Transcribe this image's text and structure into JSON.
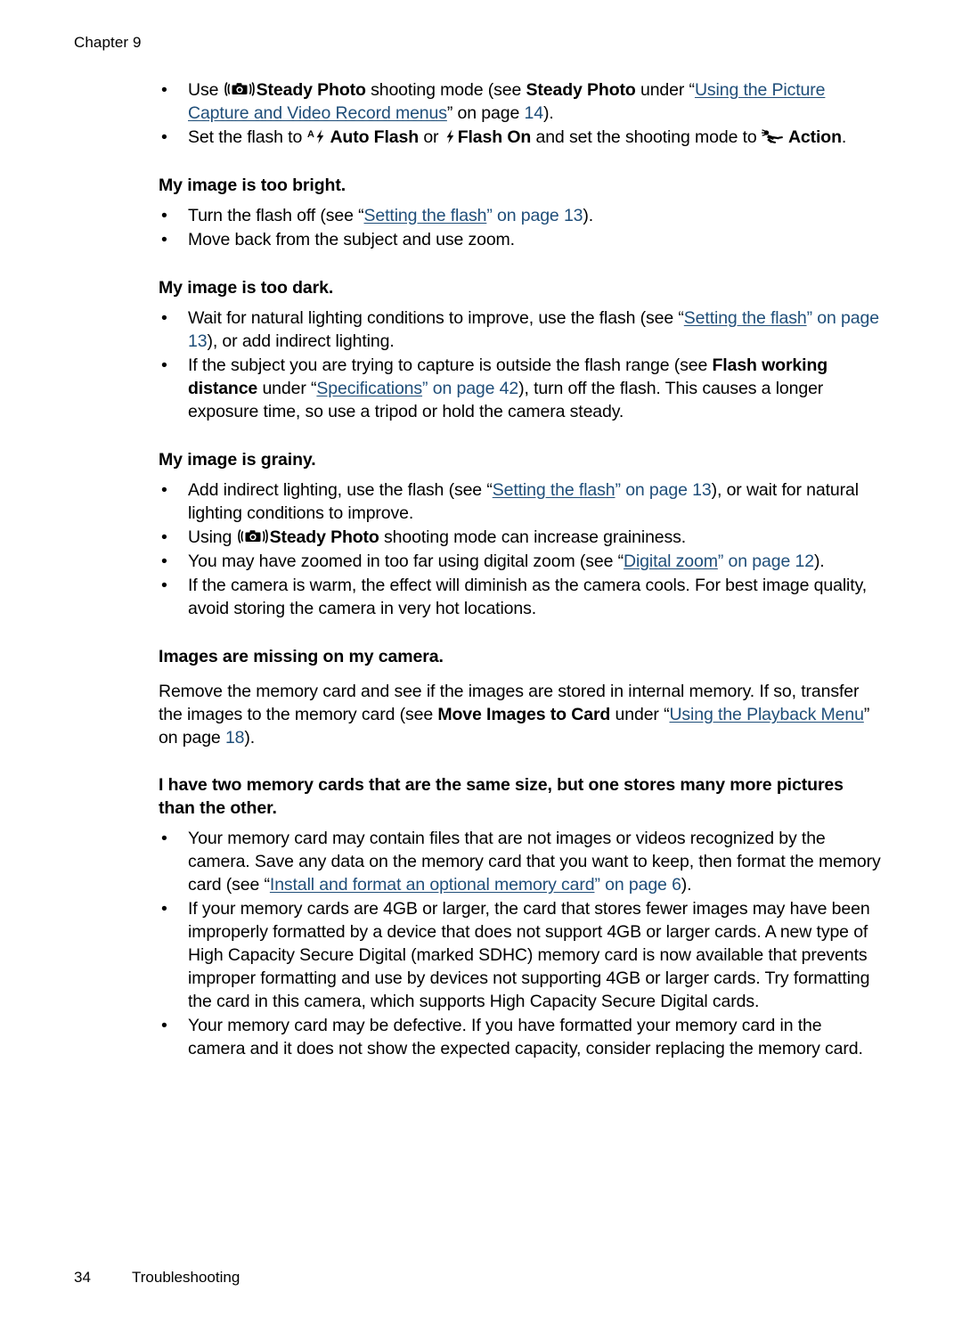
{
  "header": {
    "chapter_label": "Chapter 9"
  },
  "footer": {
    "page_number": "34",
    "section_label": "Troubleshooting"
  },
  "icons": {
    "steady_photo": "steady-photo-icon",
    "auto_flash": "auto-flash-icon",
    "flash_on": "flash-on-icon",
    "action": "action-icon"
  },
  "colors": {
    "link": "#1f4e79",
    "text": "#000000",
    "background": "#ffffff"
  },
  "intro_bullets": [
    {
      "id": "steady-photo-bullet",
      "segments": [
        {
          "type": "text",
          "value": "Use "
        },
        {
          "type": "icon",
          "value": "steady-photo-icon"
        },
        {
          "type": "bold",
          "value": "Steady Photo"
        },
        {
          "type": "text",
          "value": " shooting mode (see "
        },
        {
          "type": "bold",
          "value": "Steady Photo"
        },
        {
          "type": "text",
          "value": " under “"
        },
        {
          "type": "link",
          "value": "Using the Picture Capture and Video Record menus"
        },
        {
          "type": "text",
          "value": "” on page "
        },
        {
          "type": "link-plain",
          "value": "14"
        },
        {
          "type": "text",
          "value": ")."
        }
      ]
    },
    {
      "id": "set-flash-bullet",
      "segments": [
        {
          "type": "text",
          "value": "Set the flash to "
        },
        {
          "type": "icon",
          "value": "auto-flash-icon"
        },
        {
          "type": "bold",
          "value": "Auto Flash"
        },
        {
          "type": "text",
          "value": " or "
        },
        {
          "type": "icon",
          "value": "flash-on-icon"
        },
        {
          "type": "bold",
          "value": "Flash On"
        },
        {
          "type": "text",
          "value": " and set the shooting mode to "
        },
        {
          "type": "icon",
          "value": "action-icon"
        },
        {
          "type": "bold",
          "value": "Action"
        },
        {
          "type": "text",
          "value": "."
        }
      ]
    }
  ],
  "sections": [
    {
      "id": "too-bright",
      "heading": "My image is too bright.",
      "bullets": [
        "Turn the flash off (see “Setting the flash” on page 13).",
        "Move back from the subject and use zoom."
      ]
    },
    {
      "id": "too-dark",
      "heading": "My image is too dark.",
      "bullets": [
        "Wait for natural lighting conditions to improve, use the flash (see “Setting the flash” on page 13), or add indirect lighting.",
        "If the subject you are trying to capture is outside the flash range (see Flash working distance under “Specifications” on page 42), turn off the flash. This causes a longer exposure time, so use a tripod or hold the camera steady."
      ]
    },
    {
      "id": "grainy",
      "heading": "My image is grainy.",
      "bullets": [
        "Add indirect lighting, use the flash (see “Setting the flash” on page 13), or wait for natural lighting conditions to improve.",
        "Using  Steady Photo shooting mode can increase graininess.",
        "You may have zoomed in too far using digital zoom (see “Digital zoom” on page 12).",
        "If the camera is warm, the effect will diminish as the camera cools. For best image quality, avoid storing the camera in very hot locations."
      ]
    },
    {
      "id": "images-missing",
      "heading": "Images are missing on my camera.",
      "paragraph": "Remove the memory card and see if the images are stored in internal memory. If so, transfer the images to the memory card (see Move Images to Card under “Using the Playback Menu” on page 18)."
    },
    {
      "id": "two-memory-cards",
      "heading": "I have two memory cards that are the same size, but one stores many more pictures than the other.",
      "bullets": [
        "Your memory card may contain files that are not images or videos recognized by the camera. Save any data on the memory card that you want to keep, then format the memory card (see “Install and format an optional memory card” on page 6).",
        "If your memory cards are 4GB or larger, the card that stores fewer images may have been improperly formatted by a device that does not support 4GB or larger cards. A new type of High Capacity Secure Digital (marked SDHC) memory card is now available that prevents improper formatting and use by devices not supporting 4GB or larger cards. Try formatting the card in this camera, which supports High Capacity Secure Digital cards.",
        "Your memory card may be defective. If you have formatted your memory card in the camera and it does not show the expected capacity, consider replacing the memory card."
      ]
    }
  ],
  "inline": {
    "bullet_glyph": "•",
    "b1_use": "Use ",
    "b1_steady_bold_1": "Steady Photo",
    "b1_mid": " shooting mode (see ",
    "b1_steady_bold_2": "Steady Photo",
    "b1_under": " under “",
    "b1_link": "Using the Picture Capture and Video Record menus",
    "b1_onpage": "” on page ",
    "b1_pagenum": "14",
    "b1_end": ").",
    "b2_set": "Set the flash to ",
    "b2_auto_bold": "Auto Flash",
    "b2_or": " or ",
    "b2_flash_bold": "Flash On",
    "b2_and": " and set the shooting mode to ",
    "b2_action_bold": "Action",
    "b2_end": ".",
    "s1_b1_a": "Turn the flash off (see “",
    "s1_b1_link": "Setting the flash",
    "s1_b1_b": "” on page ",
    "s1_b1_pg": "13",
    "s1_b1_c": ").",
    "s1_b2": "Move back from the subject and use zoom.",
    "s2_b1_a": "Wait for natural lighting conditions to improve, use the flash (see “",
    "s2_b1_link": "Setting the flash",
    "s2_b1_b": "” ",
    "s2_b1_link2": "on page 13",
    "s2_b1_c": "), or add indirect lighting.",
    "s2_b2_a": "If the subject you are trying to capture is outside the flash range (see ",
    "s2_b2_bold": "Flash working distance",
    "s2_b2_b": " under “",
    "s2_b2_link": "Specifications",
    "s2_b2_c": "” ",
    "s2_b2_link2": "on page 42",
    "s2_b2_d": "), turn off the flash. This causes a longer exposure time, so use a tripod or hold the camera steady.",
    "s3_b1_a": "Add indirect lighting, use the flash (see “",
    "s3_b1_link": "Setting the flash",
    "s3_b1_b": "” ",
    "s3_b1_link2": "on page 13",
    "s3_b1_c": "), or wait for natural lighting conditions to improve.",
    "s3_b2_a": "Using ",
    "s3_b2_bold": "Steady Photo",
    "s3_b2_b": " shooting mode can increase graininess.",
    "s3_b3_a": "You may have zoomed in too far using digital zoom (see “",
    "s3_b3_link": "Digital zoom",
    "s3_b3_b": "” ",
    "s3_b3_link2": "on page 12",
    "s3_b3_c": ").",
    "s3_b4": "If the camera is warm, the effect will diminish as the camera cools. For best image quality, avoid storing the camera in very hot locations.",
    "s4_p_a": "Remove the memory card and see if the images are stored in internal memory. If so, transfer the images to the memory card (see ",
    "s4_p_bold": "Move Images to Card",
    "s4_p_b": " under “",
    "s4_p_link": "Using the Playback Menu",
    "s4_p_c": "” on page ",
    "s4_p_pg": "18",
    "s4_p_d": ").",
    "s5_b1_a": "Your memory card may contain files that are not images or videos recognized by the camera. Save any data on the memory card that you want to keep, then format the memory card (see “",
    "s5_b1_link": "Install and format an optional memory card",
    "s5_b1_b": "” ",
    "s5_b1_link2": "on page 6",
    "s5_b1_c": ").",
    "s5_b2": "If your memory cards are 4GB or larger, the card that stores fewer images may have been improperly formatted by a device that does not support 4GB or larger cards. A new type of High Capacity Secure Digital (marked SDHC) memory card is now available that prevents improper formatting and use by devices not supporting 4GB or larger cards. Try formatting the card in this camera, which supports High Capacity Secure Digital cards.",
    "s5_b3": "Your memory card may be defective. If you have formatted your memory card in the camera and it does not show the expected capacity, consider replacing the memory card."
  }
}
